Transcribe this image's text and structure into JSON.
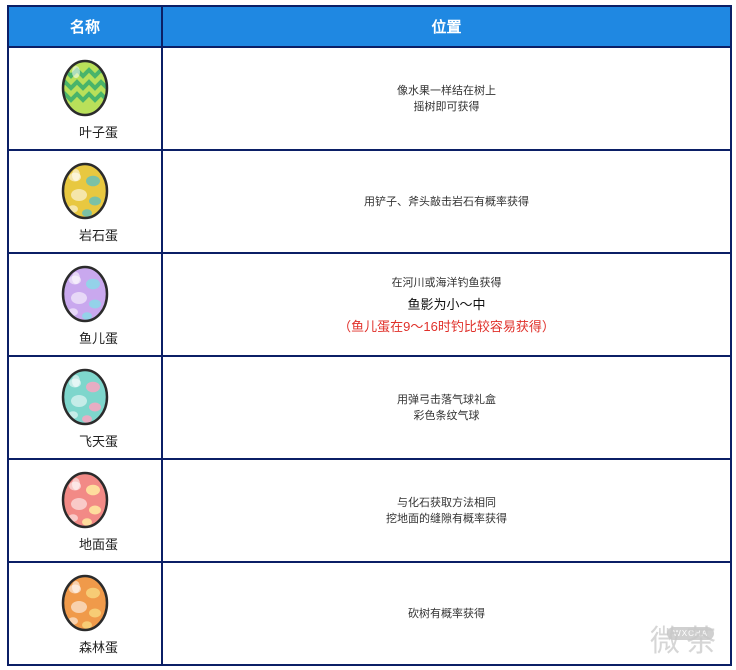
{
  "headers": {
    "name": "名称",
    "location": "位置"
  },
  "eggs": [
    {
      "name": "叶子蛋",
      "icon": "leaf-egg-icon",
      "colors": {
        "base": "#b9e05a",
        "pattern": "#49b46a",
        "dark": "#5d8e2c"
      },
      "lines": [
        "像水果一样结在树上",
        "摇树即可获得"
      ]
    },
    {
      "name": "岩石蛋",
      "icon": "rock-egg-icon",
      "colors": {
        "base": "#e8c840",
        "pattern": "#6fc0b0",
        "dark": "#8e7a20"
      },
      "lines": [
        "用铲子、斧头敲击岩石有概率获得"
      ]
    },
    {
      "name": "鱼儿蛋",
      "icon": "fish-egg-icon",
      "colors": {
        "base": "#c9a8ee",
        "pattern": "#8ed6e8",
        "dark": "#7a5aa8"
      },
      "lines": [
        "在河川或海洋钓鱼获得"
      ],
      "extra": "鱼影为小～中",
      "note": "（鱼儿蛋在9～16时钓比较容易获得）"
    },
    {
      "name": "飞天蛋",
      "icon": "sky-egg-icon",
      "colors": {
        "base": "#7ed6cc",
        "pattern": "#f3a9c2",
        "dark": "#3a9088"
      },
      "lines": [
        "用弹弓击落气球礼盒",
        "彩色条纹气球"
      ]
    },
    {
      "name": "地面蛋",
      "icon": "ground-egg-icon",
      "colors": {
        "base": "#f28a86",
        "pattern": "#ffe6a0",
        "dark": "#b84a46"
      },
      "lines": [
        "与化石获取方法相同",
        "挖地面的缝隙有概率获得"
      ]
    },
    {
      "name": "森林蛋",
      "icon": "forest-egg-icon",
      "colors": {
        "base": "#f09a4a",
        "pattern": "#f7d27a",
        "dark": "#b05a1e"
      },
      "lines": [
        "砍树有概率获得"
      ]
    }
  ],
  "watermark": {
    "text": "微茶",
    "badge": "WXCHA"
  }
}
